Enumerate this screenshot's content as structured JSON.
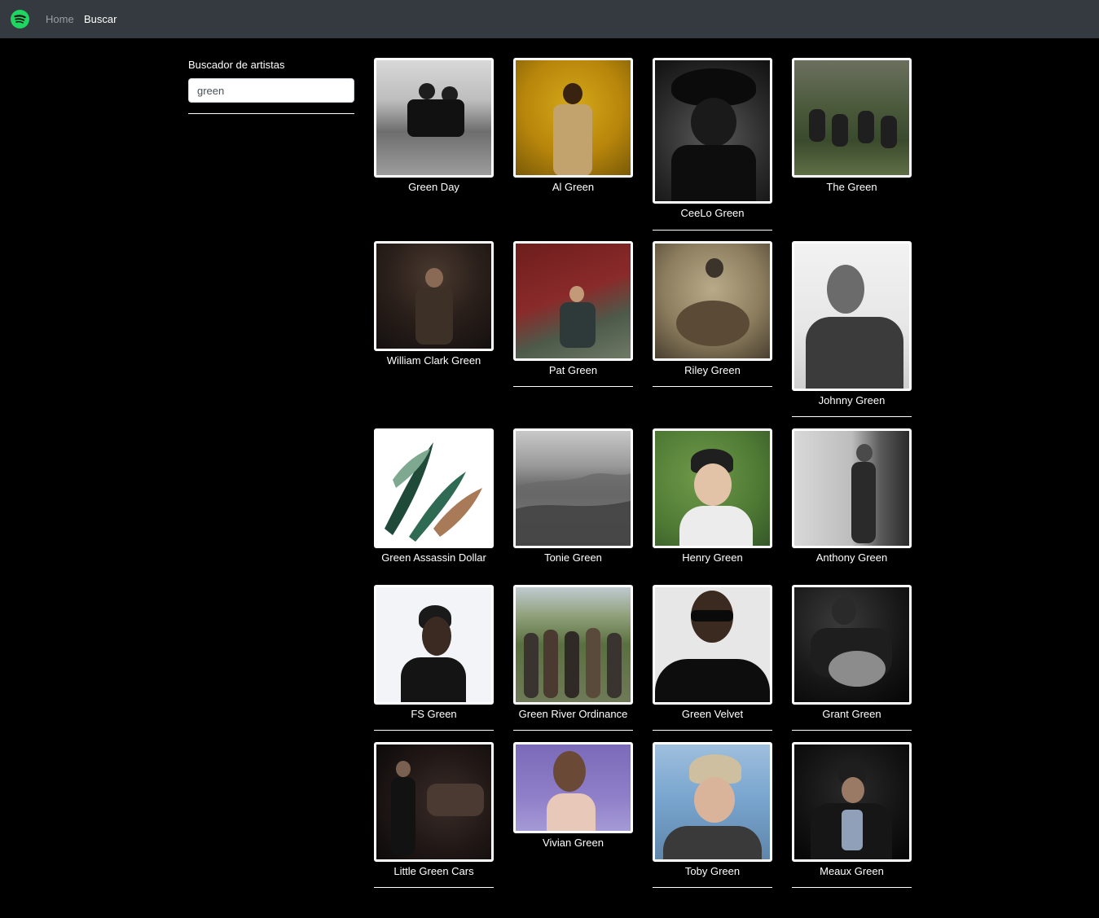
{
  "nav": {
    "logo_icon": "spotify-logo-icon",
    "brand_color": "#1ed760",
    "home_label": "Home",
    "search_label": "Buscar"
  },
  "search": {
    "label": "Buscador de artistas",
    "value": "green"
  },
  "artists": [
    {
      "name": "Green Day"
    },
    {
      "name": "Al Green"
    },
    {
      "name": "CeeLo Green"
    },
    {
      "name": "The Green"
    },
    {
      "name": "William Clark Green"
    },
    {
      "name": "Pat Green"
    },
    {
      "name": "Riley Green"
    },
    {
      "name": "Johnny Green"
    },
    {
      "name": "Green Assassin Dollar"
    },
    {
      "name": "Tonie Green"
    },
    {
      "name": "Henry Green"
    },
    {
      "name": "Anthony Green"
    },
    {
      "name": "FS Green"
    },
    {
      "name": "Green River Ordinance"
    },
    {
      "name": "Green Velvet"
    },
    {
      "name": "Grant Green"
    },
    {
      "name": "Little Green Cars"
    },
    {
      "name": "Vivian Green"
    },
    {
      "name": "Toby Green"
    },
    {
      "name": "Meaux Green"
    }
  ]
}
